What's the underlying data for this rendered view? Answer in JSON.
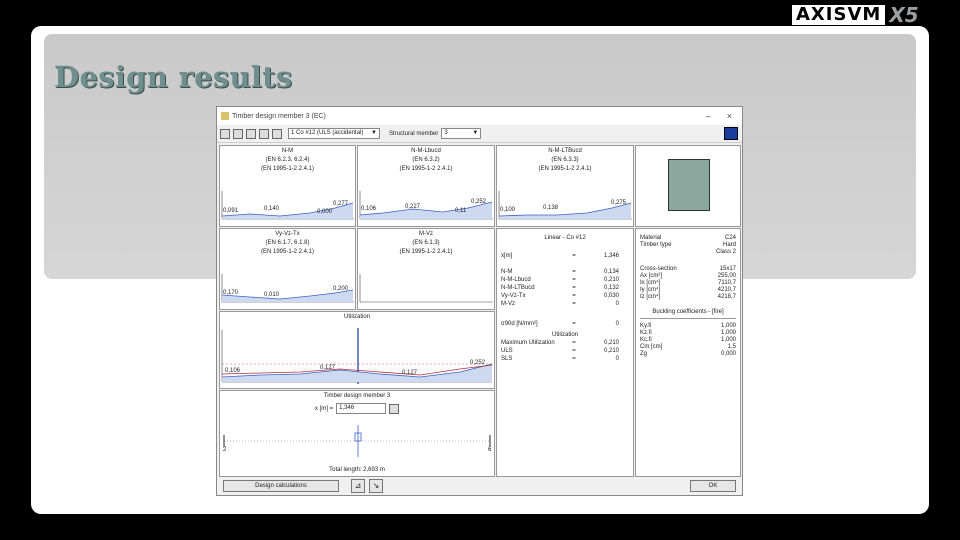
{
  "logo": {
    "brand": "AXISVM",
    "version": "X5"
  },
  "slide": {
    "title": "Design results"
  },
  "window": {
    "title": "Timber design member 3 (EC)",
    "min": "–",
    "close": "×",
    "toolbar": {
      "load_case": "1 Co #12 (ULS (accidental)",
      "member_label": "Structural member",
      "member_value": "3"
    }
  },
  "charts": {
    "nm": {
      "title": "N-M",
      "ref1": "(EN 6.2.3, 6.2.4)",
      "ref2": "(EN 1995-1-2 2.4.1)",
      "values": [
        "0,091",
        "0,140",
        "0,277",
        "0,000"
      ]
    },
    "nmledd": {
      "title": "N-M-Lbucd",
      "ref1": "(EN 6.3.2)",
      "ref2": "(EN 1995-1-2 2.4.1)",
      "values": [
        "0,106",
        "0,227",
        "0,252",
        "0,11"
      ]
    },
    "nmlt": {
      "title": "N-M-LTBucd",
      "ref1": "(EN 6.3.3)",
      "ref2": "(EN 1995-1-2 2.4.1)",
      "values": [
        "0,100",
        "0,138",
        "0,275"
      ]
    },
    "vyvz": {
      "title": "Vy-Vz-Tx",
      "ref1": "(EN 6.1.7, 6.1.8)",
      "ref2": "(EN 1995-1-2 2.4.1)",
      "values": [
        "0,170",
        "0,010",
        "0,200"
      ]
    },
    "mvz": {
      "title": "M-Vz",
      "ref1": "(EN 6.1.3)",
      "ref2": "(EN 1995-1-2 2.4.1)",
      "values": []
    },
    "utilization": {
      "title": "Utilization",
      "values": [
        "0,106",
        "0,127",
        "0,127",
        "0,252"
      ]
    }
  },
  "results": {
    "header": "Linear - Co #12",
    "x_label": "x[m]",
    "x_eq": "=",
    "x_value": "1,346",
    "rows": [
      {
        "k": "N-M",
        "eq": "=",
        "v": "0,134"
      },
      {
        "k": "N-M-Lbucd",
        "eq": "=",
        "v": "0,210"
      },
      {
        "k": "N-M-LTBucd",
        "eq": "=",
        "v": "0,132"
      },
      {
        "k": "Vy-Vz-Tx",
        "eq": "=",
        "v": "0,030"
      },
      {
        "k": "M-Vz",
        "eq": "=",
        "v": "0"
      }
    ],
    "sigma_label": "σ90d [N/mm²]",
    "sigma_eq": "=",
    "sigma_value": "0",
    "util_header": "Utilization",
    "util_rows": [
      {
        "k": "Maximum Utilization",
        "eq": "=",
        "v": "0,210"
      },
      {
        "k": "ULS",
        "eq": "=",
        "v": "0,210"
      },
      {
        "k": "SLS",
        "eq": "=",
        "v": "0"
      }
    ]
  },
  "material": {
    "rows": [
      {
        "k": "Material",
        "v": "C24"
      },
      {
        "k": "Timber type",
        "v": "Hard"
      },
      {
        "k": "",
        "v": "Class 2"
      }
    ],
    "cross_rows": [
      {
        "k": "Cross-section",
        "v": "15x17"
      },
      {
        "k": "Ax [cm²]",
        "v": "255,00"
      },
      {
        "k": "Ix [cm⁴]",
        "v": "7110,7"
      },
      {
        "k": "Iy [cm⁴]",
        "v": "4210,7"
      },
      {
        "k": "Iz [cm⁴]",
        "v": "4218,7"
      }
    ],
    "buckling_header": "Buckling coefficients - [fire]",
    "buckling_rows": [
      {
        "k": "Ky.fi",
        "v": "1,000"
      },
      {
        "k": "Kz.fi",
        "v": "1,000"
      },
      {
        "k": "Kc.fi",
        "v": "1,000"
      },
      {
        "k": "Cm [cm]",
        "v": "1,5"
      },
      {
        "k": "Zg",
        "v": "0,000"
      }
    ]
  },
  "member_panel": {
    "title": "Timber design member 3",
    "x_label": "x [m] =",
    "x_value": "1,346",
    "length": "Total length: 2,693 m",
    "left_node": "2",
    "right_node": "6"
  },
  "buttons": {
    "design_calc": "Design calculations",
    "ok": "OK"
  },
  "colors": {
    "accent": "#6e8f8d",
    "series_red": "#b0303c",
    "series_blue": "#3b62c4",
    "xsec": "#8aa89e"
  }
}
